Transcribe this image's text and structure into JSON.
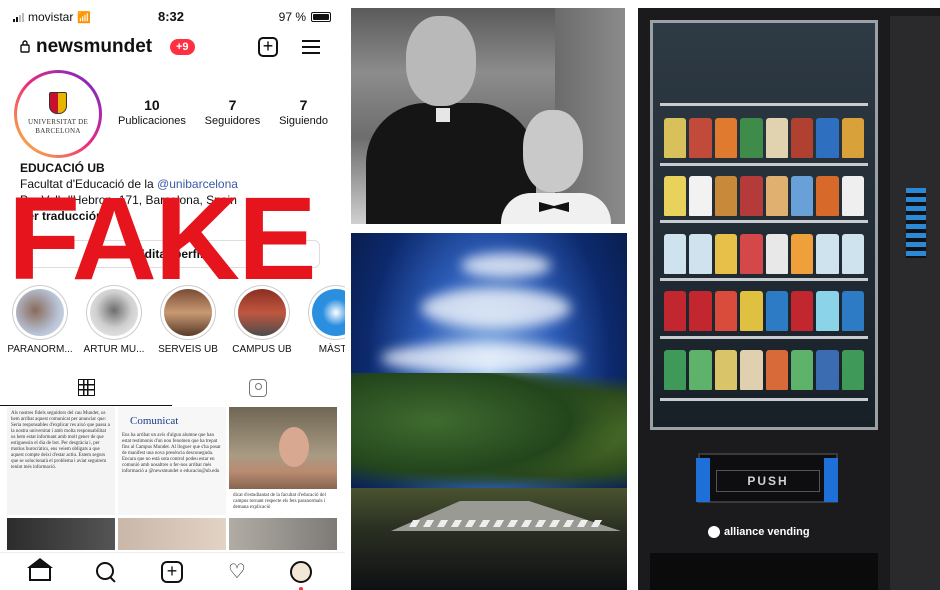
{
  "status_bar": {
    "carrier": "movistar",
    "time": "8:32",
    "battery": "97 %",
    "battery_level": 0.97
  },
  "profile": {
    "username": "newsmundet",
    "notifications_badge": "+9",
    "avatar_text_line1": "UNIVERSITAT DE",
    "avatar_text_line2": "BARCELONA",
    "stats": [
      {
        "value": "10",
        "label": "Publicaciones"
      },
      {
        "value": "7",
        "label": "Seguidores"
      },
      {
        "value": "7",
        "label": "Siguiendo"
      }
    ],
    "bio_name": "EDUCACIÓ UB",
    "bio_line1": "Facultat d'Educació de la ",
    "bio_mention": "@unibarcelona",
    "bio_line2": "Pg. Vall d'Hebron, 171, Barcelona, Spain",
    "bio_translate": "Ver traducción",
    "edit_button": "Editar perfil"
  },
  "overlay": {
    "stamp_text": "FAKE",
    "stamp_color": "#e6141c"
  },
  "highlights": [
    {
      "label": "PARANORM..."
    },
    {
      "label": "ARTUR MU..."
    },
    {
      "label": "SERVEIS UB"
    },
    {
      "label": "CAMPUS UB"
    },
    {
      "label": "MÀSTE"
    }
  ],
  "posts": {
    "post1_text": "Als nostres fidels seguidors del cau Mundet, us hem arribat aquest comunicat per anunciar que: Seria responsables d'explicar res això que passa a la nostra universitat i amb molta responsabilitat us hem estat informant amb molt gener de que estiguessin el dia de bot. Per desgràcia i, per motius burocràtics, ens veiem obligats a que aquest compte deixi d'estar actiu. Estem segurs que se solucionarà el problema i aviat seguirem tenint més informació.",
    "post2_title": "Comunicat",
    "post2_text": "Ens ha arribat un avís d'algun alumne que han estat testimonis d'un nou fenomen que ha trepat fins al Campus Mundet. Al lloguer que s'ha posat de manifest una nova presència desconeguda. Encara que no està sota control podeu estar en comunió amb nosaltres o fer-nos arribar més informació a @newsmundet o educacio@ub.edu",
    "post3_caption": "dicat d'estudiantat de la facultat d'educació del campus tornant respecte els fets paranormals i demana explicació"
  },
  "vending": {
    "push_label": "PUSH",
    "brand": "alliance vending"
  }
}
